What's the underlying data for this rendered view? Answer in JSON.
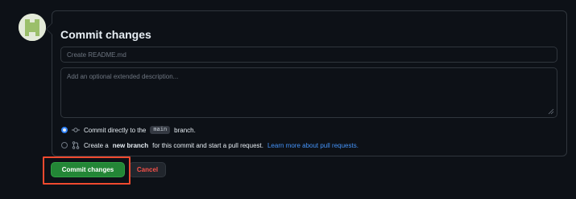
{
  "header": {
    "title": "Commit changes"
  },
  "form": {
    "summary_placeholder": "Create README.md",
    "summary_value": "",
    "description_placeholder": "Add an optional extended description...",
    "description_value": ""
  },
  "options": {
    "direct": {
      "prefix": "Commit directly to the",
      "branch": "main",
      "suffix": "branch.",
      "checked": true,
      "icon": "git-commit-icon"
    },
    "new_branch": {
      "prefix": "Create a",
      "bold": "new branch",
      "middle": "for this commit and start a pull request.",
      "link": "Learn more about pull requests.",
      "checked": false,
      "icon": "git-pull-request-icon"
    }
  },
  "actions": {
    "commit_label": "Commit changes",
    "cancel_label": "Cancel"
  },
  "colors": {
    "background": "#0d1117",
    "border": "#30363d",
    "primary_button": "#238636",
    "cancel_text": "#f85149",
    "link": "#4493f8",
    "radio_checked": "#2f81f7",
    "highlight": "#f04a2f"
  }
}
